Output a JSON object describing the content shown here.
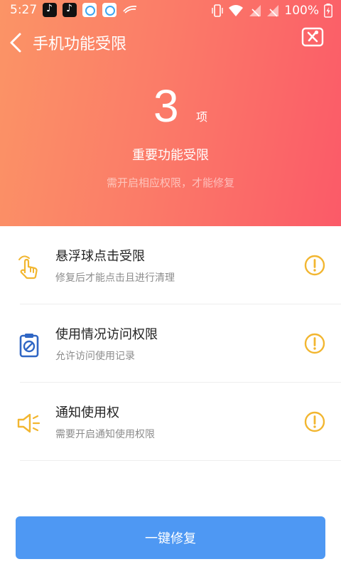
{
  "status_bar": {
    "time": "5:27",
    "battery": "100%",
    "app_icons": [
      "tiktok-icon",
      "tiktok-icon",
      "browser-icon",
      "browser-icon",
      "swoosh-icon"
    ]
  },
  "header": {
    "title": "手机功能受限",
    "count": "3",
    "count_unit": "项",
    "headline": "重要功能受限",
    "subline": "需开启相应权限，才能修复"
  },
  "items": [
    {
      "title": "悬浮球点击受限",
      "desc": "修复后才能点击且进行清理",
      "icon": "hand-tap-icon"
    },
    {
      "title": "使用情况访问权限",
      "desc": "允许访问使用记录",
      "icon": "clipboard-block-icon"
    },
    {
      "title": "通知使用权",
      "desc": "需要开启通知使用权限",
      "icon": "speaker-icon"
    }
  ],
  "button": {
    "label": "一键修复"
  },
  "colors": {
    "accent_blue": "#4e98f3",
    "warning_yellow": "#f2b630",
    "header_start": "#fb9466",
    "header_end": "#fb5a68"
  }
}
